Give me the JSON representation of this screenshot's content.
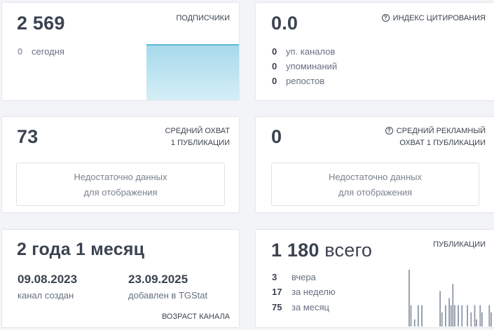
{
  "subscribers": {
    "value": "2 569",
    "label": "ПОДПИСЧИКИ",
    "today_count": "0",
    "today_label": "сегодня"
  },
  "citation": {
    "value": "0.0",
    "label": "ИНДЕКС ЦИТИРОВАНИЯ",
    "rows": [
      {
        "count": "0",
        "label": "уп. каналов"
      },
      {
        "count": "0",
        "label": "упоминаний"
      },
      {
        "count": "0",
        "label": "репостов"
      }
    ]
  },
  "reach": {
    "value": "73",
    "label_line1": "СРЕДНИЙ ОХВАТ",
    "label_line2": "1 ПУБЛИКАЦИИ",
    "no_data_line1": "Недостаточно данных",
    "no_data_line2": "для отображения"
  },
  "ad_reach": {
    "value": "0",
    "label_line1": "СРЕДНИЙ РЕКЛАМНЫЙ",
    "label_line2": "ОХВАТ 1 ПУБЛИКАЦИИ",
    "no_data_line1": "Недостаточно данных",
    "no_data_line2": "для отображения"
  },
  "age": {
    "value": "2 года 1 месяц",
    "created_date": "09.08.2023",
    "created_label": "канал создан",
    "added_date": "23.09.2025",
    "added_label": "добавлен в TGStat",
    "label": "ВОЗРАСТ КАНАЛА"
  },
  "posts": {
    "value_number": "1 180",
    "value_suffix": "всего",
    "label": "ПУБЛИКАЦИИ",
    "rows": [
      {
        "count": "3",
        "label": "вчера"
      },
      {
        "count": "17",
        "label": "за неделю"
      },
      {
        "count": "75",
        "label": "за месяц"
      }
    ]
  },
  "colors": {
    "accent_line": "#5fb8d8",
    "area_fill": "#bfe5f1",
    "bars": "#8e98a6"
  },
  "icons": [
    "help-icon",
    "help-icon"
  ],
  "chart_data": {
    "type": "bar",
    "values": [
      8,
      3,
      0,
      1,
      0,
      3,
      0,
      3,
      0,
      0,
      0,
      0,
      0,
      0,
      0,
      0,
      0,
      5,
      2,
      0,
      3,
      0,
      4,
      3,
      6,
      3,
      0,
      3,
      0,
      3,
      0,
      0,
      3,
      0,
      2,
      0,
      3,
      1,
      0,
      3,
      2,
      0,
      0,
      0,
      3,
      2,
      0,
      3
    ],
    "ylim": [
      0,
      8
    ],
    "title": "",
    "xlabel": "",
    "ylabel": ""
  }
}
